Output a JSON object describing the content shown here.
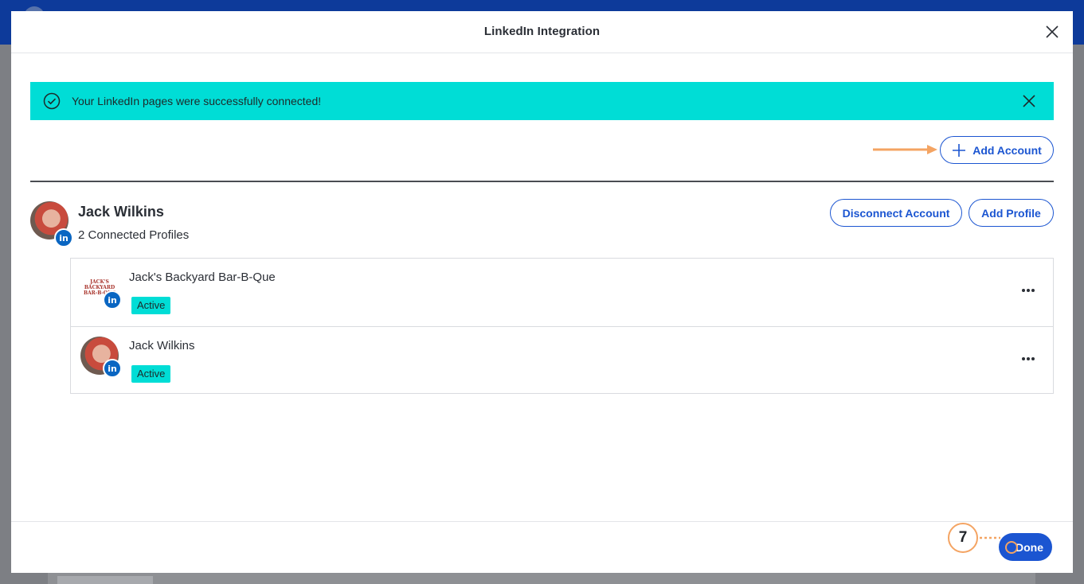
{
  "modal": {
    "title": "LinkedIn Integration"
  },
  "alert": {
    "message": "Your LinkedIn pages were successfully connected!",
    "color": "#00ddd6"
  },
  "toolbar": {
    "add_account_label": "Add Account"
  },
  "account": {
    "name": "Jack Wilkins",
    "connected_profiles": "2 Connected Profiles",
    "disconnect_label": "Disconnect Account",
    "add_profile_label": "Add Profile"
  },
  "profiles": [
    {
      "name": "Jack's Backyard Bar-B-Que",
      "status": "Active",
      "logo_text": "JACK'S BACKYARD BAR-B-QUE"
    },
    {
      "name": "Jack Wilkins",
      "status": "Active"
    }
  ],
  "badge": {
    "linkedin": "in"
  },
  "footer": {
    "done_label": "Done",
    "step_number": "7"
  },
  "icons": {
    "close": "close-icon",
    "check_circle": "check-circle-icon",
    "plus": "plus-icon",
    "more": "more-horizontal-icon",
    "linkedin": "linkedin-icon"
  },
  "colors": {
    "primary": "#1b55d1",
    "accent_teal": "#00ddd6",
    "annotation_orange": "#f4a463",
    "linkedin_blue": "#0a66c2"
  }
}
